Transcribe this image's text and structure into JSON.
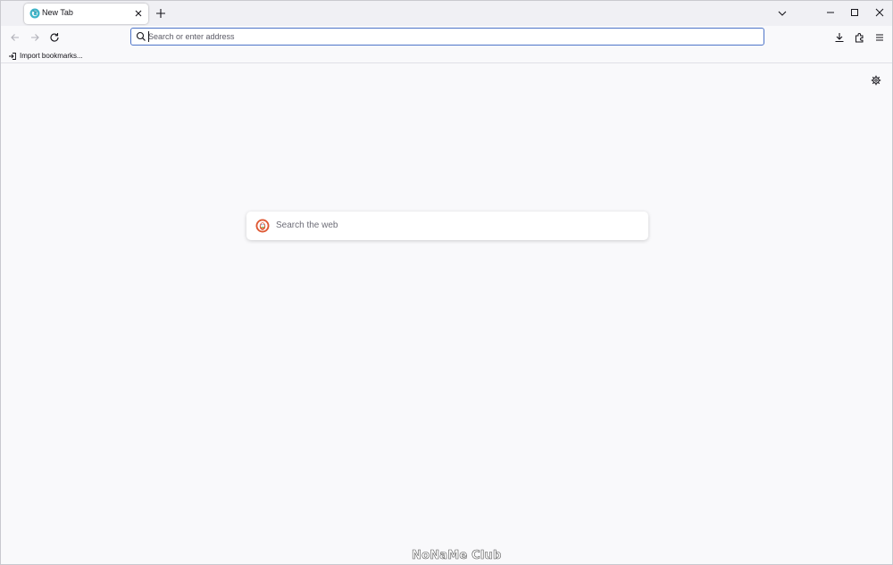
{
  "tabs": [
    {
      "title": "New Tab",
      "active": true
    }
  ],
  "urlbar": {
    "placeholder": "Search or enter address",
    "value": ""
  },
  "bookmarks_bar": {
    "items": [
      {
        "label": "Import bookmarks..."
      }
    ]
  },
  "newtab_page": {
    "search_placeholder": "Search the web",
    "search_engine_icon": "duckduckgo-icon"
  },
  "watermark": "NoNaMe Club",
  "colors": {
    "urlbar_focus_border": "#4d74c8",
    "tabstrip_bg": "#f0f0f4",
    "content_bg": "#f9f9fb",
    "duckduckgo_orange": "#de5833"
  },
  "icons": {
    "tab_favicon": "firefox-icon",
    "tab_close": "close-icon",
    "new_tab": "plus-icon",
    "list_all_tabs": "chevron-down-icon",
    "back": "arrow-left-icon",
    "forward": "arrow-right-icon",
    "reload": "reload-icon",
    "downloads": "download-icon",
    "extensions": "puzzle-icon",
    "menu": "hamburger-icon",
    "settings": "gear-icon",
    "import": "import-icon"
  }
}
